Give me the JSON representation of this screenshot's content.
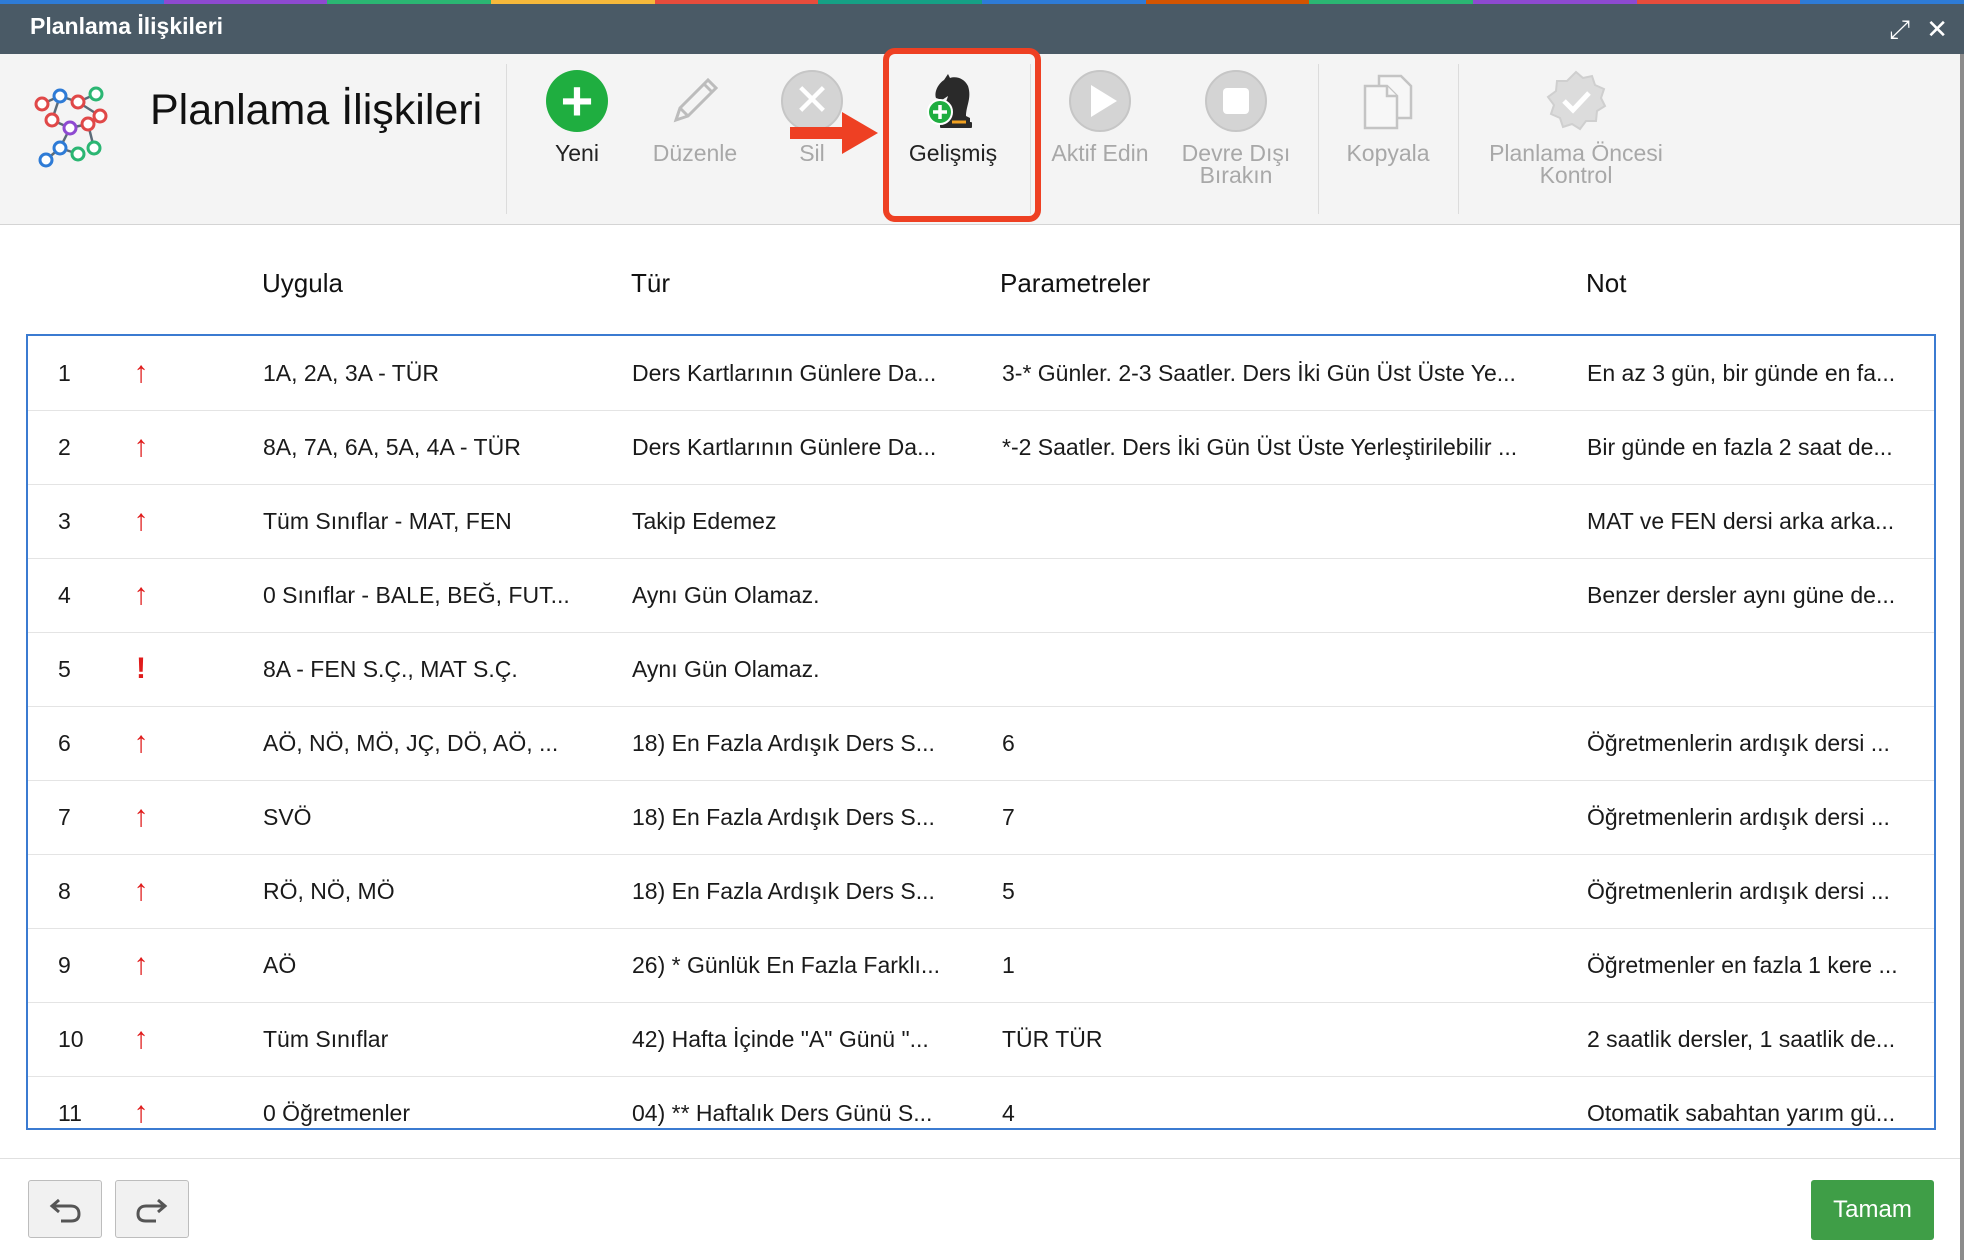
{
  "window": {
    "title": "Planlama İlişkileri",
    "expand_icon": "expand-icon",
    "close_icon": "close-icon"
  },
  "header": {
    "title": "Planlama İlişkileri",
    "logo_icon": "network-graph-icon"
  },
  "toolbar": {
    "buttons": [
      {
        "label": "Yeni",
        "icon": "add-icon",
        "enabled": true
      },
      {
        "label": "Düzenle",
        "icon": "pencil-icon",
        "enabled": false
      },
      {
        "label": "Sil",
        "icon": "delete-icon",
        "enabled": false
      },
      {
        "label": "Gelişmiş",
        "icon": "chess-knight-icon",
        "enabled": true,
        "highlighted": true
      },
      {
        "label": "Aktif Edin",
        "icon": "play-icon",
        "enabled": false
      },
      {
        "label": "Devre Dışı\nBırakın",
        "label_line1": "Devre Dışı",
        "label_line2": "Bırakın",
        "icon": "stop-icon",
        "enabled": false
      },
      {
        "label": "Kopyala",
        "icon": "copy-icon",
        "enabled": false
      },
      {
        "label": "Planlama Öncesi Kontrol",
        "label_line1": "Planlama Öncesi",
        "label_line2": "Kontrol",
        "icon": "check-badge-icon",
        "enabled": false
      }
    ],
    "highlight_color": "#ee4023"
  },
  "table": {
    "columns": [
      "Uygula",
      "Tür",
      "Parametreler",
      "Not"
    ],
    "rows": [
      {
        "num": "1",
        "priority": "↑",
        "uygula": "1A, 2A, 3A - TÜR",
        "tur": "Ders Kartlarının Günlere Da...",
        "parametreler": "3-* Günler. 2-3 Saatler. Ders İki Gün Üst Üste Ye...",
        "not": "En az 3 gün, bir günde en fa..."
      },
      {
        "num": "2",
        "priority": "↑",
        "uygula": "8A, 7A, 6A, 5A, 4A - TÜR",
        "tur": "Ders Kartlarının Günlere Da...",
        "parametreler": "*-2 Saatler. Ders İki Gün Üst Üste Yerleştirilebilir ...",
        "not": "Bir günde en fazla 2 saat de..."
      },
      {
        "num": "3",
        "priority": "↑",
        "uygula": "Tüm Sınıflar - MAT, FEN",
        "tur": "Takip Edemez",
        "parametreler": "",
        "not": "MAT ve FEN dersi arka arka..."
      },
      {
        "num": "4",
        "priority": "↑",
        "uygula": "0 Sınıflar - BALE, BEĞ, FUT...",
        "tur": "Aynı Gün Olamaz.",
        "parametreler": "",
        "not": "Benzer dersler aynı güne de..."
      },
      {
        "num": "5",
        "priority": "!",
        "uygula": "8A - FEN S.Ç., MAT S.Ç.",
        "tur": "Aynı Gün Olamaz.",
        "parametreler": "",
        "not": ""
      },
      {
        "num": "6",
        "priority": "↑",
        "uygula": "AÖ, NÖ, MÖ, JÇ, DÖ, AÖ, ...",
        "tur": "18) En Fazla Ardışık Ders S...",
        "parametreler": "6",
        "not": "Öğretmenlerin ardışık dersi ..."
      },
      {
        "num": "7",
        "priority": "↑",
        "uygula": "SVÖ",
        "tur": "18) En Fazla Ardışık Ders S...",
        "parametreler": "7",
        "not": "Öğretmenlerin ardışık dersi ..."
      },
      {
        "num": "8",
        "priority": "↑",
        "uygula": "RÖ, NÖ, MÖ",
        "tur": "18) En Fazla Ardışık Ders S...",
        "parametreler": "5",
        "not": "Öğretmenlerin ardışık dersi ..."
      },
      {
        "num": "9",
        "priority": "↑",
        "uygula": "AÖ",
        "tur": "26) * Günlük En Fazla Farklı...",
        "parametreler": "1",
        "not": "Öğretmenler en fazla 1 kere ..."
      },
      {
        "num": "10",
        "priority": "↑",
        "uygula": "Tüm Sınıflar",
        "tur": "42) Hafta İçinde \"A\" Günü \"...",
        "parametreler": "TÜR TÜR",
        "not": "2 saatlik dersler, 1 saatlik de..."
      },
      {
        "num": "11",
        "priority": "↑",
        "uygula": "0 Öğretmenler",
        "tur": "04) ** Haftalık Ders Günü S...",
        "parametreler": "4",
        "not": "Otomatik sabahtan yarım gü..."
      }
    ],
    "priority_color": "#e01b1b",
    "border_color": "#3b7bd1"
  },
  "footer": {
    "undo_icon": "undo-icon",
    "redo_icon": "redo-icon",
    "ok_label": "Tamam",
    "ok_color": "#3f9e47"
  }
}
